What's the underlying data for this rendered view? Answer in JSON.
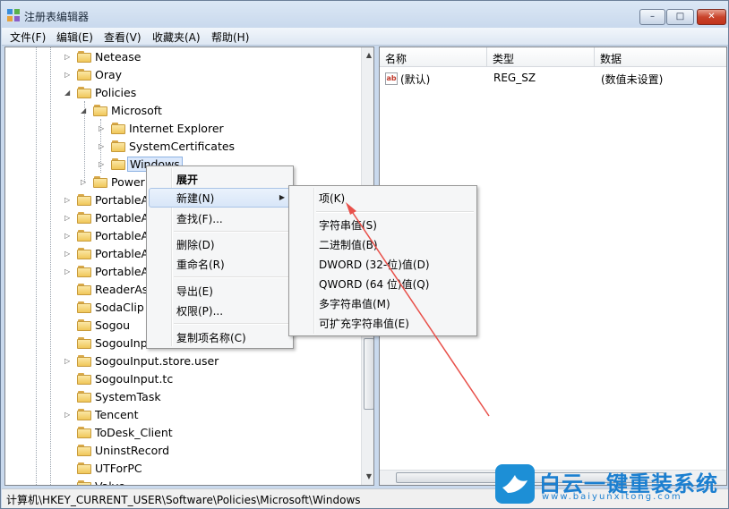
{
  "window": {
    "title": "注册表编辑器"
  },
  "window_controls": {
    "min": "–",
    "max": "□",
    "close": "✕"
  },
  "menubar": [
    {
      "label": "文件(F)"
    },
    {
      "label": "编辑(E)"
    },
    {
      "label": "查看(V)"
    },
    {
      "label": "收藏夹(A)"
    },
    {
      "label": "帮助(H)"
    }
  ],
  "tree": {
    "items": [
      {
        "label": "Netease",
        "expander": "▷"
      },
      {
        "label": "Oray",
        "expander": "▷"
      },
      {
        "label": "Policies",
        "expander": "◢"
      },
      {
        "label": "Microsoft",
        "expander": "◢"
      },
      {
        "label": "Internet Explorer",
        "expander": "▷"
      },
      {
        "label": "SystemCertificates",
        "expander": "▷"
      },
      {
        "label": "Windows",
        "expander": "▷"
      },
      {
        "label": "Power",
        "expander": "▷"
      },
      {
        "label": "PortableA",
        "expander": "▷"
      },
      {
        "label": "PortableA",
        "expander": "▷"
      },
      {
        "label": "PortableA",
        "expander": "▷"
      },
      {
        "label": "PortableA",
        "expander": "▷"
      },
      {
        "label": "PortableA",
        "expander": "▷"
      },
      {
        "label": "ReaderAs",
        "expander": ""
      },
      {
        "label": "SodaClip",
        "expander": ""
      },
      {
        "label": "Sogou",
        "expander": ""
      },
      {
        "label": "SogouInpu",
        "expander": ""
      },
      {
        "label": "SogouInput.store.user",
        "expander": "▷"
      },
      {
        "label": "SogouInput.tc",
        "expander": ""
      },
      {
        "label": "SystemTask",
        "expander": ""
      },
      {
        "label": "Tencent",
        "expander": "▷"
      },
      {
        "label": "ToDesk_Client",
        "expander": ""
      },
      {
        "label": "UninstRecord",
        "expander": ""
      },
      {
        "label": "UTForPC",
        "expander": ""
      },
      {
        "label": "Valve",
        "expander": ""
      }
    ],
    "scroll_up": "▲",
    "scroll_down": "▼"
  },
  "list": {
    "columns": [
      "名称",
      "类型",
      "数据"
    ],
    "rows": [
      {
        "name": "(默认)",
        "type": "REG_SZ",
        "data": "(数值未设置)",
        "icon": "ab"
      }
    ]
  },
  "context_menu": {
    "items": [
      {
        "label": "展开"
      },
      {
        "label": "新建(N)"
      },
      {
        "label": "查找(F)..."
      },
      {
        "label": "删除(D)"
      },
      {
        "label": "重命名(R)"
      },
      {
        "label": "导出(E)"
      },
      {
        "label": "权限(P)..."
      },
      {
        "label": "复制项名称(C)"
      }
    ],
    "submenu_arrow": "▶"
  },
  "submenu": {
    "items": [
      {
        "label": "项(K)"
      },
      {
        "label": "字符串值(S)"
      },
      {
        "label": "二进制值(B)"
      },
      {
        "label": "DWORD (32-位)值(D)"
      },
      {
        "label": "QWORD (64 位)值(Q)"
      },
      {
        "label": "多字符串值(M)"
      },
      {
        "label": "可扩充字符串值(E)"
      }
    ]
  },
  "statusbar": {
    "path": "计算机\\HKEY_CURRENT_USER\\Software\\Policies\\Microsoft\\Windows"
  },
  "watermark": {
    "text": "白云一键重装系统",
    "url": "www.baiyunxitong.com"
  },
  "colors": {
    "accent": "#1d8fd6",
    "arrow": "#e8504a",
    "selection": "#dbe8fb"
  }
}
